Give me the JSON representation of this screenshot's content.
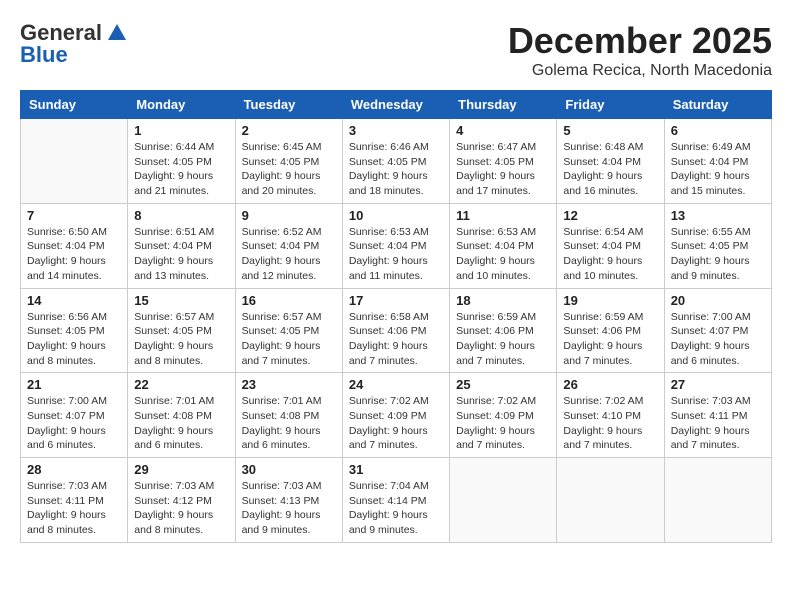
{
  "logo": {
    "general": "General",
    "blue": "Blue"
  },
  "title": "December 2025",
  "location": "Golema Recica, North Macedonia",
  "days_of_week": [
    "Sunday",
    "Monday",
    "Tuesday",
    "Wednesday",
    "Thursday",
    "Friday",
    "Saturday"
  ],
  "weeks": [
    [
      {
        "day": "",
        "info": ""
      },
      {
        "day": "1",
        "info": "Sunrise: 6:44 AM\nSunset: 4:05 PM\nDaylight: 9 hours\nand 21 minutes."
      },
      {
        "day": "2",
        "info": "Sunrise: 6:45 AM\nSunset: 4:05 PM\nDaylight: 9 hours\nand 20 minutes."
      },
      {
        "day": "3",
        "info": "Sunrise: 6:46 AM\nSunset: 4:05 PM\nDaylight: 9 hours\nand 18 minutes."
      },
      {
        "day": "4",
        "info": "Sunrise: 6:47 AM\nSunset: 4:05 PM\nDaylight: 9 hours\nand 17 minutes."
      },
      {
        "day": "5",
        "info": "Sunrise: 6:48 AM\nSunset: 4:04 PM\nDaylight: 9 hours\nand 16 minutes."
      },
      {
        "day": "6",
        "info": "Sunrise: 6:49 AM\nSunset: 4:04 PM\nDaylight: 9 hours\nand 15 minutes."
      }
    ],
    [
      {
        "day": "7",
        "info": "Sunrise: 6:50 AM\nSunset: 4:04 PM\nDaylight: 9 hours\nand 14 minutes."
      },
      {
        "day": "8",
        "info": "Sunrise: 6:51 AM\nSunset: 4:04 PM\nDaylight: 9 hours\nand 13 minutes."
      },
      {
        "day": "9",
        "info": "Sunrise: 6:52 AM\nSunset: 4:04 PM\nDaylight: 9 hours\nand 12 minutes."
      },
      {
        "day": "10",
        "info": "Sunrise: 6:53 AM\nSunset: 4:04 PM\nDaylight: 9 hours\nand 11 minutes."
      },
      {
        "day": "11",
        "info": "Sunrise: 6:53 AM\nSunset: 4:04 PM\nDaylight: 9 hours\nand 10 minutes."
      },
      {
        "day": "12",
        "info": "Sunrise: 6:54 AM\nSunset: 4:04 PM\nDaylight: 9 hours\nand 10 minutes."
      },
      {
        "day": "13",
        "info": "Sunrise: 6:55 AM\nSunset: 4:05 PM\nDaylight: 9 hours\nand 9 minutes."
      }
    ],
    [
      {
        "day": "14",
        "info": "Sunrise: 6:56 AM\nSunset: 4:05 PM\nDaylight: 9 hours\nand 8 minutes."
      },
      {
        "day": "15",
        "info": "Sunrise: 6:57 AM\nSunset: 4:05 PM\nDaylight: 9 hours\nand 8 minutes."
      },
      {
        "day": "16",
        "info": "Sunrise: 6:57 AM\nSunset: 4:05 PM\nDaylight: 9 hours\nand 7 minutes."
      },
      {
        "day": "17",
        "info": "Sunrise: 6:58 AM\nSunset: 4:06 PM\nDaylight: 9 hours\nand 7 minutes."
      },
      {
        "day": "18",
        "info": "Sunrise: 6:59 AM\nSunset: 4:06 PM\nDaylight: 9 hours\nand 7 minutes."
      },
      {
        "day": "19",
        "info": "Sunrise: 6:59 AM\nSunset: 4:06 PM\nDaylight: 9 hours\nand 7 minutes."
      },
      {
        "day": "20",
        "info": "Sunrise: 7:00 AM\nSunset: 4:07 PM\nDaylight: 9 hours\nand 6 minutes."
      }
    ],
    [
      {
        "day": "21",
        "info": "Sunrise: 7:00 AM\nSunset: 4:07 PM\nDaylight: 9 hours\nand 6 minutes."
      },
      {
        "day": "22",
        "info": "Sunrise: 7:01 AM\nSunset: 4:08 PM\nDaylight: 9 hours\nand 6 minutes."
      },
      {
        "day": "23",
        "info": "Sunrise: 7:01 AM\nSunset: 4:08 PM\nDaylight: 9 hours\nand 6 minutes."
      },
      {
        "day": "24",
        "info": "Sunrise: 7:02 AM\nSunset: 4:09 PM\nDaylight: 9 hours\nand 7 minutes."
      },
      {
        "day": "25",
        "info": "Sunrise: 7:02 AM\nSunset: 4:09 PM\nDaylight: 9 hours\nand 7 minutes."
      },
      {
        "day": "26",
        "info": "Sunrise: 7:02 AM\nSunset: 4:10 PM\nDaylight: 9 hours\nand 7 minutes."
      },
      {
        "day": "27",
        "info": "Sunrise: 7:03 AM\nSunset: 4:11 PM\nDaylight: 9 hours\nand 7 minutes."
      }
    ],
    [
      {
        "day": "28",
        "info": "Sunrise: 7:03 AM\nSunset: 4:11 PM\nDaylight: 9 hours\nand 8 minutes."
      },
      {
        "day": "29",
        "info": "Sunrise: 7:03 AM\nSunset: 4:12 PM\nDaylight: 9 hours\nand 8 minutes."
      },
      {
        "day": "30",
        "info": "Sunrise: 7:03 AM\nSunset: 4:13 PM\nDaylight: 9 hours\nand 9 minutes."
      },
      {
        "day": "31",
        "info": "Sunrise: 7:04 AM\nSunset: 4:14 PM\nDaylight: 9 hours\nand 9 minutes."
      },
      {
        "day": "",
        "info": ""
      },
      {
        "day": "",
        "info": ""
      },
      {
        "day": "",
        "info": ""
      }
    ]
  ]
}
